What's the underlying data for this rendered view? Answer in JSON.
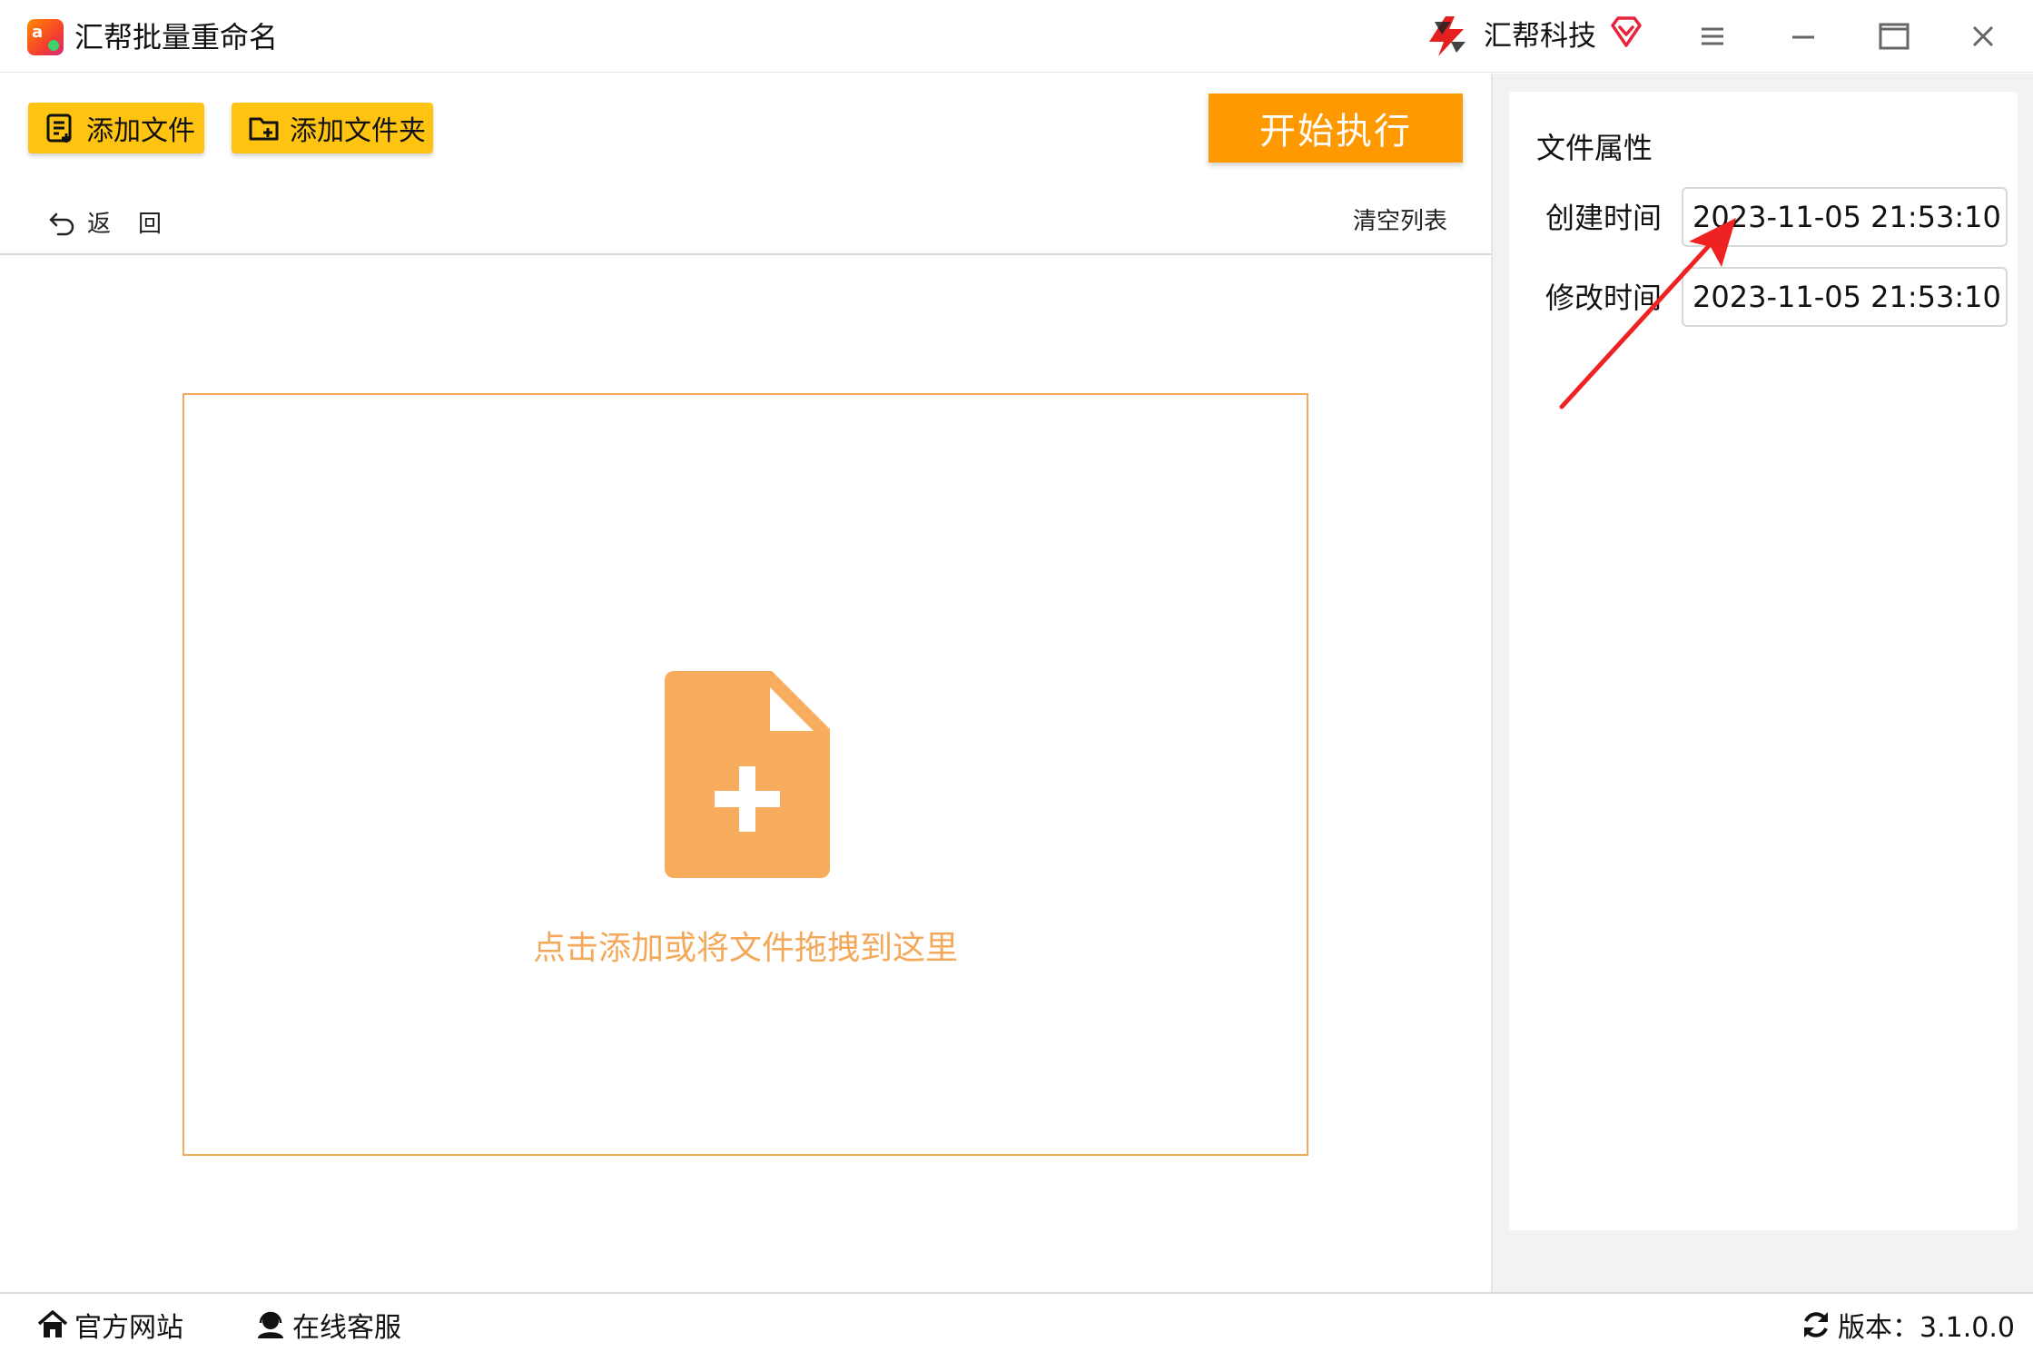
{
  "titlebar": {
    "app_title": "汇帮批量重命名",
    "app_icon_text": "a",
    "brand_name": "汇帮科技",
    "icons": [
      "app-logo-icon",
      "brand-logo-icon",
      "vip-diamond-icon",
      "menu-icon",
      "minimize-icon",
      "maximize-icon",
      "close-icon"
    ]
  },
  "toolbar": {
    "add_file_label": "添加文件",
    "add_folder_label": "添加文件夹",
    "start_label": "开始执行",
    "back_label": "返回",
    "clear_list_label": "清空列表"
  },
  "dropzone": {
    "hint": "点击添加或将文件拖拽到这里"
  },
  "properties": {
    "title": "文件属性",
    "created_label": "创建时间",
    "created_value": "2023-11-05 21:53:10",
    "modified_label": "修改时间",
    "modified_value": "2023-11-05 21:53:10"
  },
  "statusbar": {
    "website_label": "官方网站",
    "support_label": "在线客服",
    "version_label": "版本：3.1.0.0"
  },
  "colors": {
    "accent_yellow": "#ffc312",
    "start_orange": "#ff9900",
    "drop_orange": "#f4a95a",
    "annotation_red": "#ee2222"
  }
}
